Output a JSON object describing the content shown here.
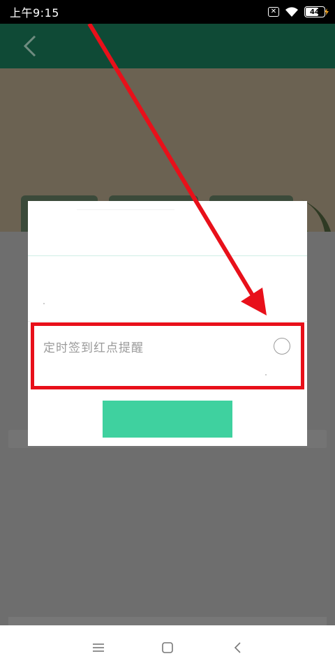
{
  "status_bar": {
    "time": "上午9:15",
    "battery_level": "44",
    "icons": [
      "sim-no-service-icon",
      "wifi-icon",
      "battery-icon"
    ]
  },
  "header": {
    "back_icon": "back-chevron-icon"
  },
  "dialog": {
    "option_label": "定时签到红点提醒",
    "option_checked": false,
    "confirm_label": ""
  },
  "nav_bar": {
    "items": [
      "menu-icon",
      "home-icon",
      "back-icon"
    ]
  },
  "colors": {
    "header_bg": "#0f4a36",
    "highlight": "#e8101a",
    "confirm_button": "#3fd19f",
    "overlay_gray": "#6e6e6e"
  }
}
